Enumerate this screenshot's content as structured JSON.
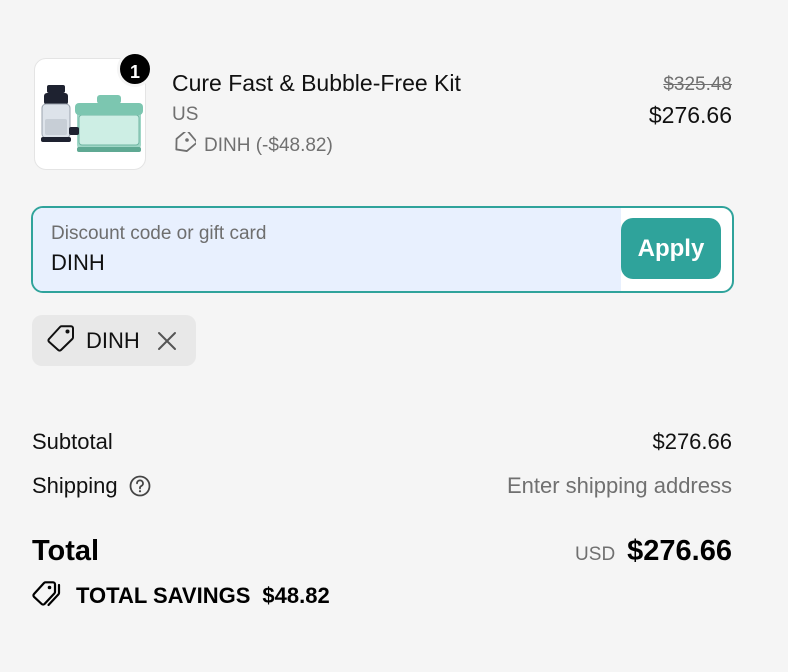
{
  "product": {
    "quantity": "1",
    "name": "Cure Fast & Bubble-Free Kit",
    "variant": "US",
    "discount_text": "DINH (-$48.82)",
    "original_price": "$325.48",
    "price": "$276.66"
  },
  "discount": {
    "label": "Discount code or gift card",
    "value": "DINH",
    "apply_label": "Apply"
  },
  "applied_code": {
    "label": "DINH"
  },
  "summary": {
    "subtotal_label": "Subtotal",
    "subtotal_value": "$276.66",
    "shipping_label": "Shipping",
    "shipping_value": "Enter shipping address",
    "total_label": "Total",
    "currency": "USD",
    "total_value": "$276.66",
    "savings_label": "TOTAL SAVINGS",
    "savings_value": "$48.82"
  },
  "colors": {
    "accent": "#2fa39b",
    "field_fill": "#e8f0fe",
    "background": "#f5f5f5"
  },
  "icons": [
    "product-image",
    "tag-icon",
    "close-icon",
    "help-circle-icon",
    "tags-icon"
  ]
}
